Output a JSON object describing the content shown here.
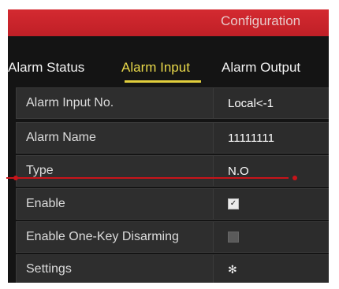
{
  "header": {
    "title": "Configuration"
  },
  "tabs": [
    {
      "label": "Alarm Status",
      "active": false
    },
    {
      "label": "Alarm Input",
      "active": true
    },
    {
      "label": "Alarm Output",
      "active": false
    }
  ],
  "form": {
    "alarm_input_no": {
      "label": "Alarm Input No.",
      "value": "Local<-1"
    },
    "alarm_name": {
      "label": "Alarm Name",
      "value": "11111111"
    },
    "type": {
      "label": "Type",
      "value": "N.O"
    },
    "enable": {
      "label": "Enable",
      "checked": true
    },
    "one_key": {
      "label": "Enable One-Key Disarming",
      "checked": false
    },
    "settings": {
      "label": "Settings",
      "icon": "gear-icon"
    }
  },
  "colors": {
    "title_bar": "#c5222a",
    "active_tab": "#e8d84a",
    "annotation_line": "#c8141a"
  }
}
